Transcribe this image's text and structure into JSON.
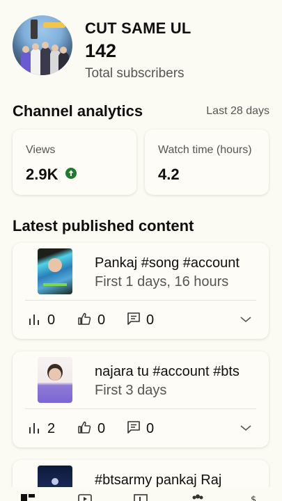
{
  "channel": {
    "name": "CUT SAME UL",
    "subscribers": "142",
    "subscribers_label": "Total subscribers"
  },
  "analytics": {
    "title": "Channel analytics",
    "range": "Last 28 days",
    "stats": [
      {
        "label": "Views",
        "value": "2.9K",
        "trend": "up"
      },
      {
        "label": "Watch time (hours)",
        "value": "4.2"
      }
    ]
  },
  "latest": {
    "title": "Latest published content",
    "items": [
      {
        "title": "Pankaj #song #account",
        "subtitle": "First 1 days, 16 hours",
        "views": "0",
        "likes": "0",
        "comments": "0"
      },
      {
        "title": "najara tu #account  #bts",
        "subtitle": "First 3 days",
        "views": "2",
        "likes": "0",
        "comments": "0"
      },
      {
        "title": "#btsarmy pankaj Raj",
        "subtitle": "",
        "views": "",
        "likes": "",
        "comments": ""
      }
    ]
  },
  "colors": {
    "background": "#fcfbf3",
    "trend_up": "#1f7a2c"
  },
  "icons": [
    "bar-chart-icon",
    "thumbs-up-icon",
    "comment-icon",
    "chevron-down-icon",
    "trend-up-icon"
  ]
}
